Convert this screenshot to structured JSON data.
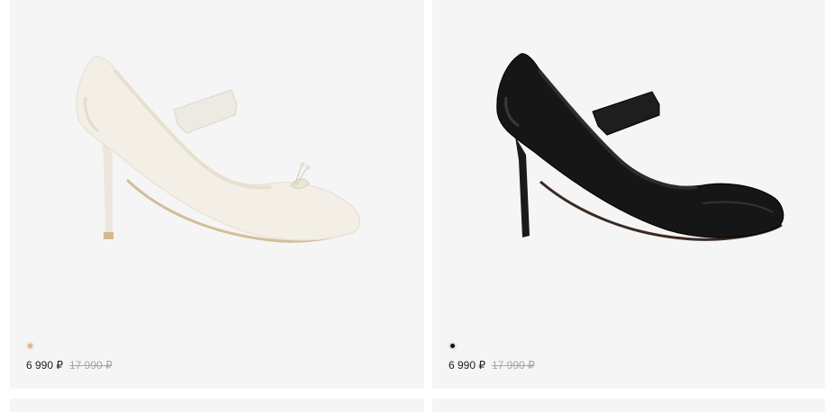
{
  "products": [
    {
      "price": "6 990 ₽",
      "old_price": "17 990 ₽",
      "image": "beige-mary-jane-pump",
      "color_swatch": "#d9b590"
    },
    {
      "price": "6 990 ₽",
      "old_price": "17 990 ₽",
      "image": "black-mary-jane-pump",
      "color_swatch": "#111111"
    }
  ]
}
